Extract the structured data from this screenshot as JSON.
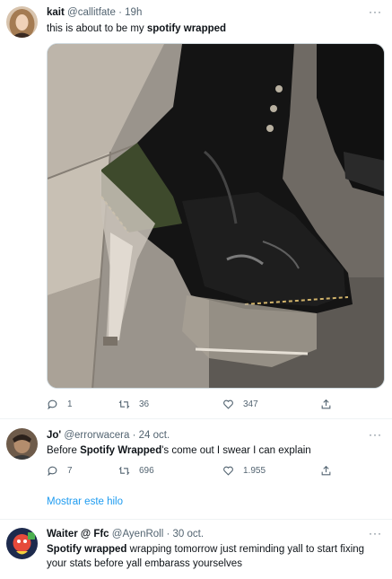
{
  "tweet1": {
    "name": "kait",
    "handle": "@callitfate",
    "time": "19h",
    "text_pre": "this is about to be my ",
    "text_bold": "spotify wrapped",
    "replies": "1",
    "retweets": "36",
    "likes": "347"
  },
  "tweet2": {
    "name": "Jo'",
    "handle": "@errorwacera",
    "time": "24 oct.",
    "text_pre": "Before ",
    "text_bold": "Spotify Wrapped",
    "text_post": "'s come out I swear I can explain",
    "replies": "7",
    "retweets": "696",
    "likes": "1.955",
    "show_thread": "Mostrar este hilo"
  },
  "tweet3": {
    "name": "Waiter @ Ffc",
    "handle": "@AyenRoll",
    "time": "30 oct.",
    "text_bold": "Spotify wrapped",
    "text_post": " wrapping tomorrow just reminding yall to start fixing your stats before yall embarass yourselves"
  },
  "separator": "·",
  "more_glyph": "···",
  "colors": {
    "link": "#1d9bf0",
    "secondary": "#536471",
    "divider": "#eff3f4"
  },
  "icons": [
    "reply-icon",
    "retweet-icon",
    "like-icon",
    "share-icon",
    "more-icon"
  ]
}
